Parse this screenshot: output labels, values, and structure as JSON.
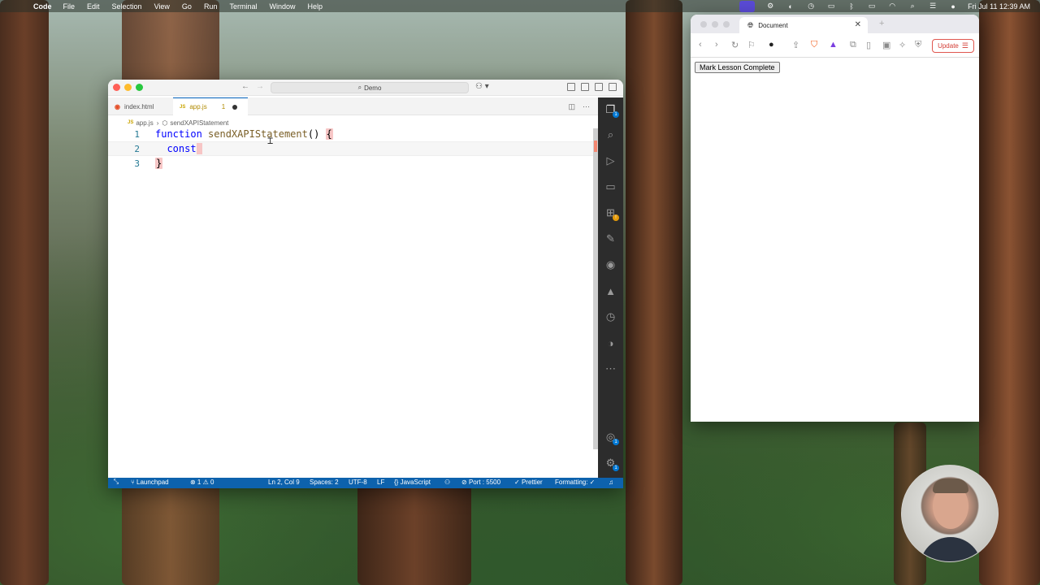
{
  "menubar": {
    "app_name": "Code",
    "items": [
      "File",
      "Edit",
      "Selection",
      "View",
      "Go",
      "Run",
      "Terminal",
      "Window",
      "Help"
    ],
    "clock": "Fri Jul 11  12:39 AM"
  },
  "vscode": {
    "command_center": "Demo",
    "tabs": [
      {
        "label": "index.html",
        "icon": "html-file-icon"
      },
      {
        "label": "app.js",
        "icon": "js-file-icon",
        "problems": "1",
        "dirty": true
      }
    ],
    "breadcrumb": {
      "file": "app.js",
      "symbol": "sendXAPIStatement"
    },
    "code": {
      "line_numbers": [
        "1",
        "2",
        "3"
      ],
      "line1": {
        "keyword": "function",
        "name": "sendXAPIStatement",
        "params": "()",
        "brace": "{"
      },
      "line2": {
        "keyword": "const"
      },
      "line3": {
        "brace": "}"
      }
    },
    "statusbar": {
      "branch": "Launchpad",
      "problems": "⊗ 1 ⚠ 0",
      "cursor": "Ln 2, Col 9",
      "spaces": "Spaces: 2",
      "encoding": "UTF-8",
      "eol": "LF",
      "language": "JavaScript",
      "port": "Port : 5500",
      "prettier": "Prettier",
      "formatting": "Formatting: ✓"
    },
    "activity_badges": {
      "explorer": "1",
      "extensions": "!",
      "accounts": "1",
      "settings": "1"
    }
  },
  "browser": {
    "tab_title": "Document",
    "update_label": "Update",
    "button_label": "Mark Lesson Complete"
  }
}
